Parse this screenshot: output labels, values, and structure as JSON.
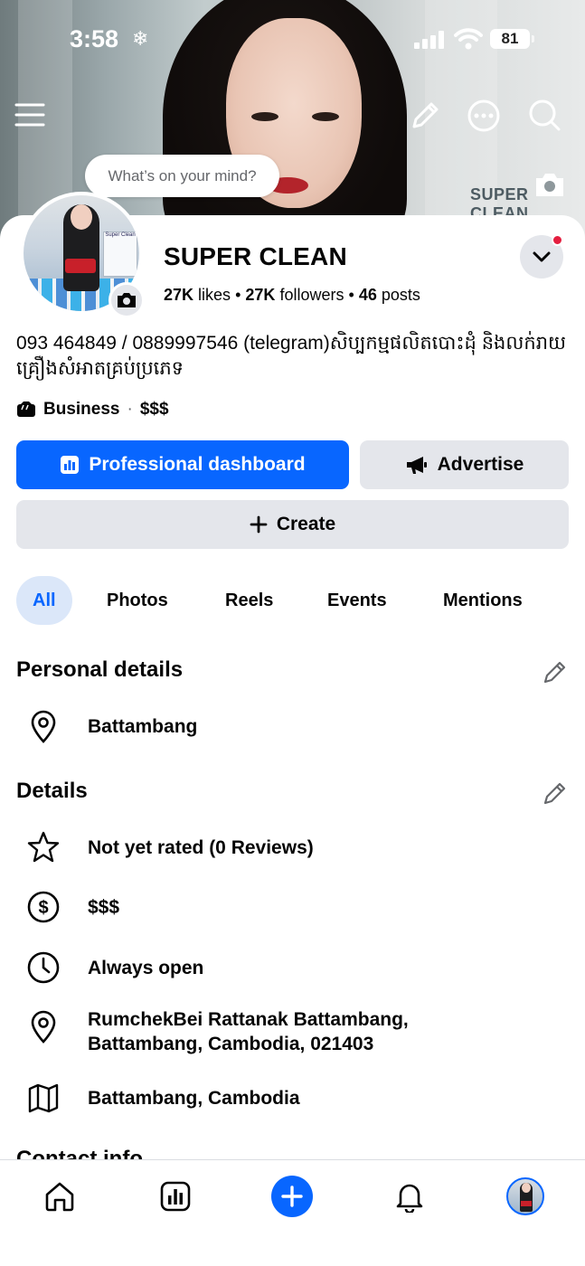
{
  "status_bar": {
    "time": "3:58",
    "focus_icon": "snowflake-icon",
    "battery": "81"
  },
  "cover": {
    "sign_text": "SUPER CLEAN"
  },
  "composer_bubble": {
    "placeholder": "What’s on your mind?"
  },
  "profile": {
    "name": "SUPER CLEAN",
    "likes_count": "27K",
    "likes_label": "likes",
    "followers_count": "27K",
    "followers_label": "followers",
    "posts_count": "46",
    "posts_label": "posts",
    "separator": "•",
    "bio": "093 464849 / 0889997546 (telegram)សិប្បកម្មផលិតបោះដុំ និងលក់រាយគ្រឿងសំអាតគ្រប់ប្រភេទ",
    "category": "Business",
    "price": "$$$",
    "avatar_box_text": "Super Clean"
  },
  "actions": {
    "professional_dashboard": "Professional dashboard",
    "advertise": "Advertise",
    "create": "Create"
  },
  "tabs": [
    {
      "label": "All",
      "active": true
    },
    {
      "label": "Photos",
      "active": false
    },
    {
      "label": "Reels",
      "active": false
    },
    {
      "label": "Events",
      "active": false
    },
    {
      "label": "Mentions",
      "active": false
    }
  ],
  "personal_details": {
    "title": "Personal details",
    "items": [
      {
        "icon": "location-pin-icon",
        "text": "Battambang"
      }
    ]
  },
  "details": {
    "title": "Details",
    "items": [
      {
        "icon": "star-icon",
        "text": "Not yet rated (0 Reviews)"
      },
      {
        "icon": "dollar-circle-icon",
        "text": "$$$"
      },
      {
        "icon": "clock-icon",
        "text": "Always open"
      },
      {
        "icon": "location-pin-icon",
        "line1": "RumchekBei Rattanak Battambang,",
        "line2": "Battambang, Cambodia, 021403"
      },
      {
        "icon": "map-icon",
        "text": "Battambang, Cambodia"
      }
    ]
  },
  "next_section_peek": "Contact info",
  "colors": {
    "accent": "#0866ff",
    "button_gray": "#e4e6eb",
    "notification_red": "#e41e3f",
    "tab_active_bg": "#dbe7f9"
  }
}
